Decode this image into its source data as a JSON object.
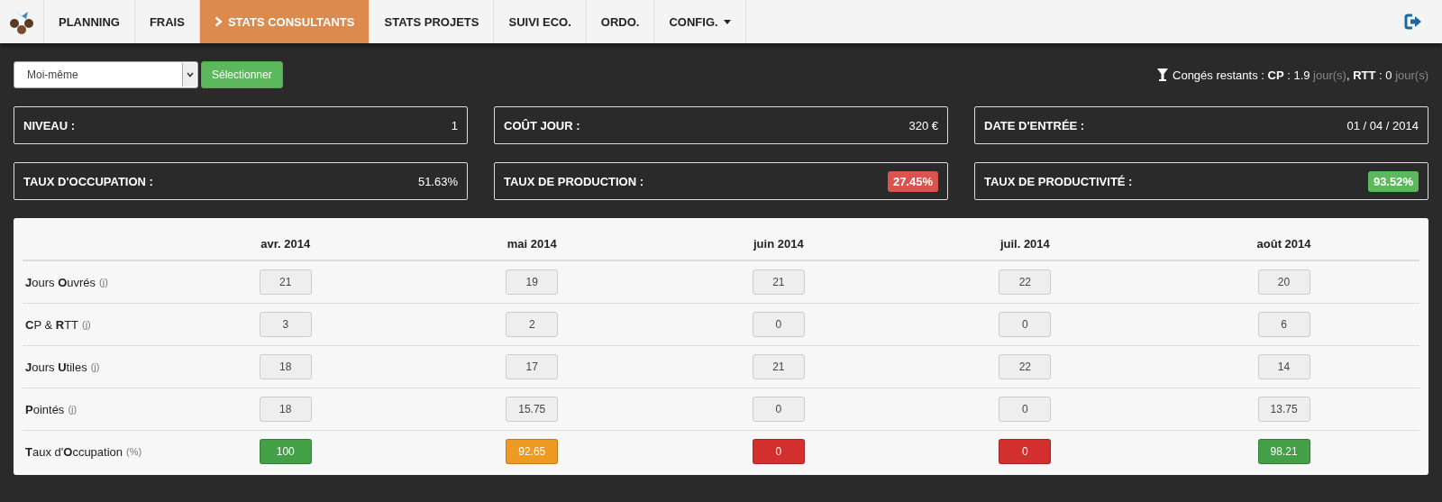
{
  "nav": {
    "items": [
      {
        "label": "PLANNING",
        "selected": false,
        "dropdown": false
      },
      {
        "label": "FRAIS",
        "selected": false,
        "dropdown": false
      },
      {
        "label": "STATS CONSULTANTS",
        "selected": true,
        "dropdown": false
      },
      {
        "label": "STATS PROJETS",
        "selected": false,
        "dropdown": false
      },
      {
        "label": "SUIVI ECO.",
        "selected": false,
        "dropdown": false
      },
      {
        "label": "ORDO.",
        "selected": false,
        "dropdown": false
      },
      {
        "label": "CONFIG.",
        "selected": false,
        "dropdown": true
      }
    ]
  },
  "toolbar": {
    "consultant_select": {
      "value": "Moi-même"
    },
    "select_button": "Sélectionner",
    "leave": [
      {
        "text": "Congés restants : ",
        "kind": "normal"
      },
      {
        "text": "CP",
        "kind": "bold"
      },
      {
        "text": " : 1.9 ",
        "kind": "normal"
      },
      {
        "text": "jour(s)",
        "kind": "muted"
      },
      {
        "text": ", ",
        "kind": "normal"
      },
      {
        "text": "RTT",
        "kind": "bold"
      },
      {
        "text": " : 0 ",
        "kind": "normal"
      },
      {
        "text": "jour(s)",
        "kind": "muted"
      }
    ]
  },
  "stats": [
    {
      "label": "NIVEAU :",
      "value": "1",
      "kind": "plain"
    },
    {
      "label": "COÛT JOUR :",
      "value": "320 €",
      "kind": "plain"
    },
    {
      "label": "DATE D'ENTRÉE :",
      "value": "01 / 04 / 2014",
      "kind": "plain"
    },
    {
      "label": "TAUX D'OCCUPATION :",
      "value": "51.63%",
      "kind": "plain"
    },
    {
      "label": "TAUX DE PRODUCTION :",
      "value": "27.45%",
      "kind": "badge",
      "color": "#d9534f"
    },
    {
      "label": "TAUX DE PRODUCTIVITÉ :",
      "value": "93.52%",
      "kind": "badge",
      "color": "#5cb85c"
    }
  ],
  "table": {
    "columns": [
      "avr. 2014",
      "mai 2014",
      "juin 2014",
      "juil. 2014",
      "août 2014"
    ],
    "rows": [
      {
        "label": "**J**ours **O**uvrés",
        "unit": "(j)",
        "cells": [
          {
            "value": "21",
            "kind": "plain"
          },
          {
            "value": "19",
            "kind": "plain"
          },
          {
            "value": "21",
            "kind": "plain"
          },
          {
            "value": "22",
            "kind": "plain"
          },
          {
            "value": "20",
            "kind": "plain"
          }
        ]
      },
      {
        "label": "**C**P & **R**TT",
        "unit": "(j)",
        "cells": [
          {
            "value": "3",
            "kind": "plain"
          },
          {
            "value": "2",
            "kind": "plain"
          },
          {
            "value": "0",
            "kind": "plain"
          },
          {
            "value": "0",
            "kind": "plain"
          },
          {
            "value": "6",
            "kind": "plain"
          }
        ]
      },
      {
        "label": "**J**ours **U**tiles",
        "unit": "(j)",
        "cells": [
          {
            "value": "18",
            "kind": "plain"
          },
          {
            "value": "17",
            "kind": "plain"
          },
          {
            "value": "21",
            "kind": "plain"
          },
          {
            "value": "22",
            "kind": "plain"
          },
          {
            "value": "14",
            "kind": "plain"
          }
        ]
      },
      {
        "label": "**P**ointés",
        "unit": "(j)",
        "cells": [
          {
            "value": "18",
            "kind": "plain"
          },
          {
            "value": "15.75",
            "kind": "plain"
          },
          {
            "value": "0",
            "kind": "plain"
          },
          {
            "value": "0",
            "kind": "plain"
          },
          {
            "value": "13.75",
            "kind": "plain"
          }
        ]
      },
      {
        "label": "**T**aux d'**O**ccupation",
        "unit": "(%)",
        "cells": [
          {
            "value": "100",
            "kind": "status",
            "color": "#43a047"
          },
          {
            "value": "92.65",
            "kind": "status",
            "color": "#ef9a22"
          },
          {
            "value": "0",
            "kind": "status",
            "color": "#d32f2f"
          },
          {
            "value": "0",
            "kind": "status",
            "color": "#d32f2f"
          },
          {
            "value": "98.21",
            "kind": "status",
            "color": "#43a047"
          }
        ]
      }
    ]
  }
}
